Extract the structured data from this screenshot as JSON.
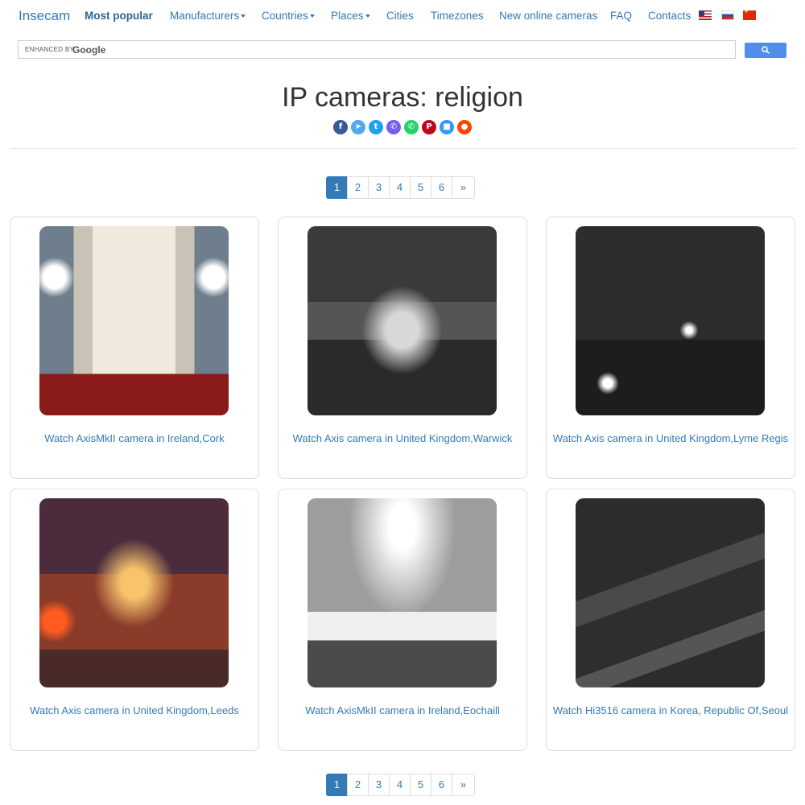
{
  "nav": {
    "brand": "Insecam",
    "most_popular": "Most popular",
    "manufacturers": "Manufacturers",
    "countries": "Countries",
    "places": "Places",
    "cities": "Cities",
    "timezones": "Timezones",
    "new_online": "New online cameras",
    "faq": "FAQ",
    "contacts": "Contacts",
    "flags": [
      "flag-us-icon",
      "flag-ru-icon",
      "flag-cn-icon"
    ]
  },
  "search": {
    "enhanced_by": "ENHANCED BY",
    "google": "Google",
    "button_icon": "search-icon"
  },
  "title": "IP cameras: religion",
  "share": [
    {
      "icon": "facebook-icon",
      "glyph": "f",
      "color": "#3b5998"
    },
    {
      "icon": "telegram-icon",
      "glyph": "➤",
      "color": "#54a9eb"
    },
    {
      "icon": "twitter-icon",
      "glyph": "t",
      "color": "#1da1f2"
    },
    {
      "icon": "viber-icon",
      "glyph": "✆",
      "color": "#7360f2"
    },
    {
      "icon": "whatsapp-icon",
      "glyph": "✆",
      "color": "#25d366"
    },
    {
      "icon": "pinterest-icon",
      "glyph": "P",
      "color": "#bd081c"
    },
    {
      "icon": "delicious-icon",
      "glyph": "■",
      "color": "#3399ff"
    },
    {
      "icon": "reddit-icon",
      "glyph": "●",
      "color": "#ff4500"
    }
  ],
  "pagination": {
    "pages": [
      "1",
      "2",
      "3",
      "4",
      "5",
      "6"
    ],
    "next": "»",
    "active": "1"
  },
  "cameras": [
    {
      "caption": "Watch AxisMkII camera in Ireland,Cork"
    },
    {
      "caption": "Watch Axis camera in United Kingdom,Warwick"
    },
    {
      "caption": "Watch Axis camera in United Kingdom,Lyme Regis"
    },
    {
      "caption": "Watch Axis camera in United Kingdom,Leeds"
    },
    {
      "caption": "Watch AxisMkII camera in Ireland,Eochaill"
    },
    {
      "caption": "Watch Hi3516 camera in Korea, Republic Of,Seoul"
    }
  ]
}
